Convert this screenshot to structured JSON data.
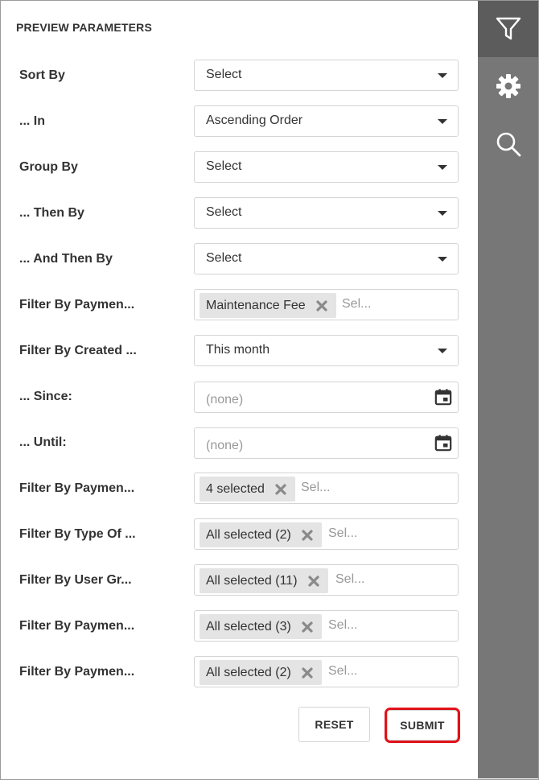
{
  "panel": {
    "title": "PREVIEW PARAMETERS"
  },
  "parameters": [
    {
      "label": "Sort By",
      "value": "Select"
    },
    {
      "label": "... In",
      "value": "Ascending Order"
    },
    {
      "label": "Group By",
      "value": "Select"
    },
    {
      "label": "... Then By",
      "value": "Select"
    },
    {
      "label": "... And Then By",
      "value": "Select"
    },
    {
      "label": "Filter By Paymen...",
      "tag": "Maintenance Fee",
      "input_placeholder": "Sel..."
    },
    {
      "label": "Filter By Created ...",
      "value": "This month"
    },
    {
      "label": "... Since:",
      "placeholder": "(none)"
    },
    {
      "label": "... Until:",
      "placeholder": "(none)"
    },
    {
      "label": "Filter By Paymen...",
      "tag": "4 selected",
      "input_placeholder": "Sel..."
    },
    {
      "label": "Filter By Type Of ...",
      "tag": "All selected (2)",
      "input_placeholder": "Sel..."
    },
    {
      "label": "Filter By User Gr...",
      "tag": "All selected (11)",
      "input_placeholder": "Sel..."
    },
    {
      "label": "Filter By Paymen...",
      "tag": "All selected (3)",
      "input_placeholder": "Sel..."
    },
    {
      "label": "Filter By Paymen...",
      "tag": "All selected (2)",
      "input_placeholder": "Sel..."
    }
  ],
  "buttons": {
    "reset": "RESET",
    "submit": "SUBMIT"
  },
  "sidebar": {
    "icons": [
      "filter-icon",
      "gear-icon",
      "search-icon"
    ],
    "active": "filter-icon"
  },
  "colors": {
    "sidebar_bg": "#777777",
    "sidebar_active": "#5c5c5c",
    "submit_highlight": "#e0121a",
    "tag_bg": "#e4e4e4"
  }
}
